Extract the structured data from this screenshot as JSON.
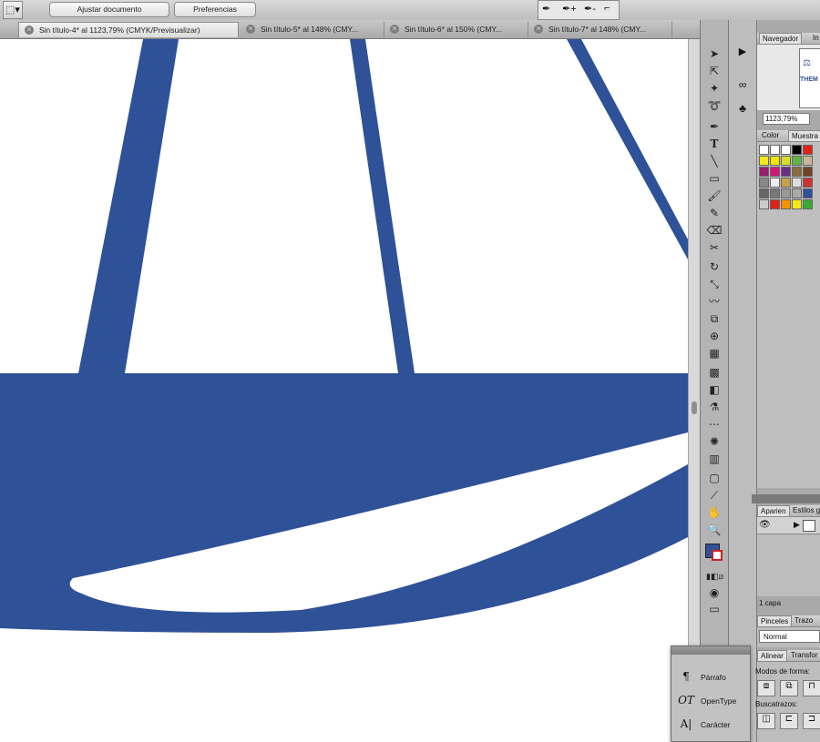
{
  "control_bar": {
    "fit_document_label": "Ajustar documento",
    "preferences_label": "Preferencias"
  },
  "tabs": [
    {
      "label": "Sin título-4* al 1123,79% (CMYK/Previsualizar)"
    },
    {
      "label": "Sin título-5* al 148% (CMY..."
    },
    {
      "label": "Sin título-6* al 150% (CMY..."
    },
    {
      "label": "Sin título-7* al 148% (CMY..."
    }
  ],
  "navigator": {
    "tab_label": "Navegador",
    "tab2_label": "In",
    "thumb_text": "THEM",
    "zoom_value": "1123,79%"
  },
  "color_panel": {
    "tab_color": "Color",
    "tab_swatches": "Muestra"
  },
  "appearance_panel": {
    "tab_appearance": "Aparien",
    "tab_styles": "Estilos g",
    "layers_count": "1 capa"
  },
  "brushes_panel": {
    "tab_brushes": "Pinceles",
    "tab_stroke": "Trazo",
    "blend_mode": "Normal"
  },
  "align_panel": {
    "tab_align": "Alinear",
    "tab_transform": "Transfor",
    "shape_modes_label": "Modos de forma:",
    "pathfinders_label": "Buscatrazos:"
  },
  "type_panel": {
    "items": [
      {
        "label": "Párrafo",
        "icon": "¶"
      },
      {
        "label": "OpenType",
        "icon": "OT"
      },
      {
        "label": "Carácter",
        "icon": "A|"
      }
    ]
  },
  "colors": {
    "artwork_blue": "#2e5198",
    "canvas": "#ffffff"
  }
}
